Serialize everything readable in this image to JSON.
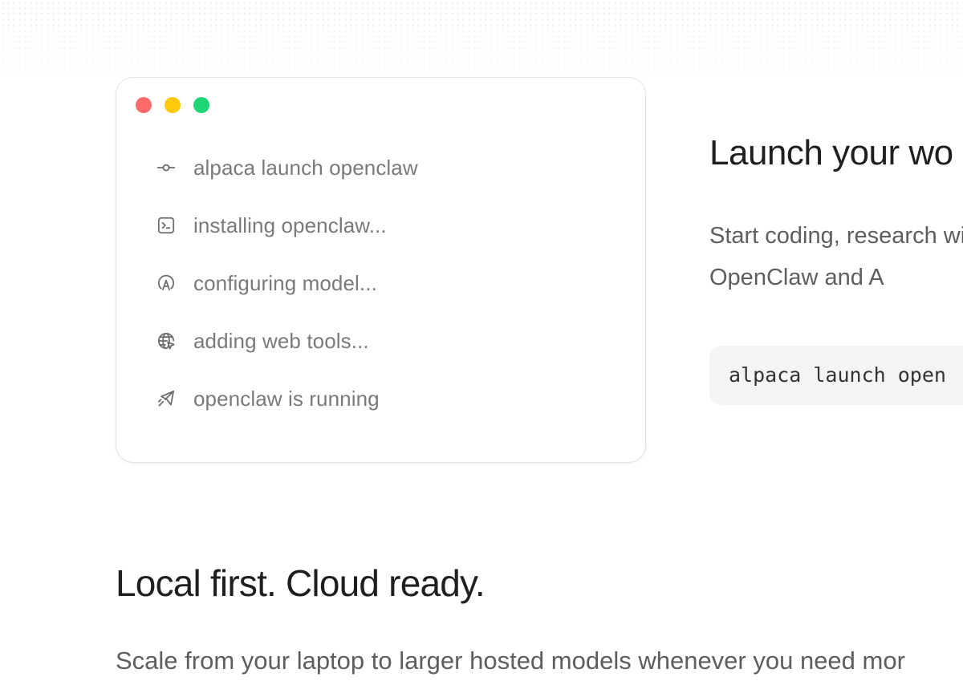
{
  "terminal": {
    "traffic_lights": {
      "close_color": "#ff6b6b",
      "minimize_color": "#ffc90b",
      "maximize_color": "#1ed674"
    },
    "steps": [
      {
        "icon": "git-commit-icon",
        "text": "alpaca launch openclaw"
      },
      {
        "icon": "terminal-icon",
        "text": "installing openclaw..."
      },
      {
        "icon": "model-icon",
        "text": "configuring model..."
      },
      {
        "icon": "globe-cursor-icon",
        "text": "adding web tools..."
      },
      {
        "icon": "send-icon",
        "text": "openclaw is running"
      }
    ]
  },
  "launch_section": {
    "heading": "Launch your wo",
    "description": "Start coding, research with OpenClaw and A",
    "command": "alpaca launch open"
  },
  "local_section": {
    "heading": "Local first. Cloud ready.",
    "description": "Scale from your laptop to larger hosted models whenever you need mor"
  }
}
